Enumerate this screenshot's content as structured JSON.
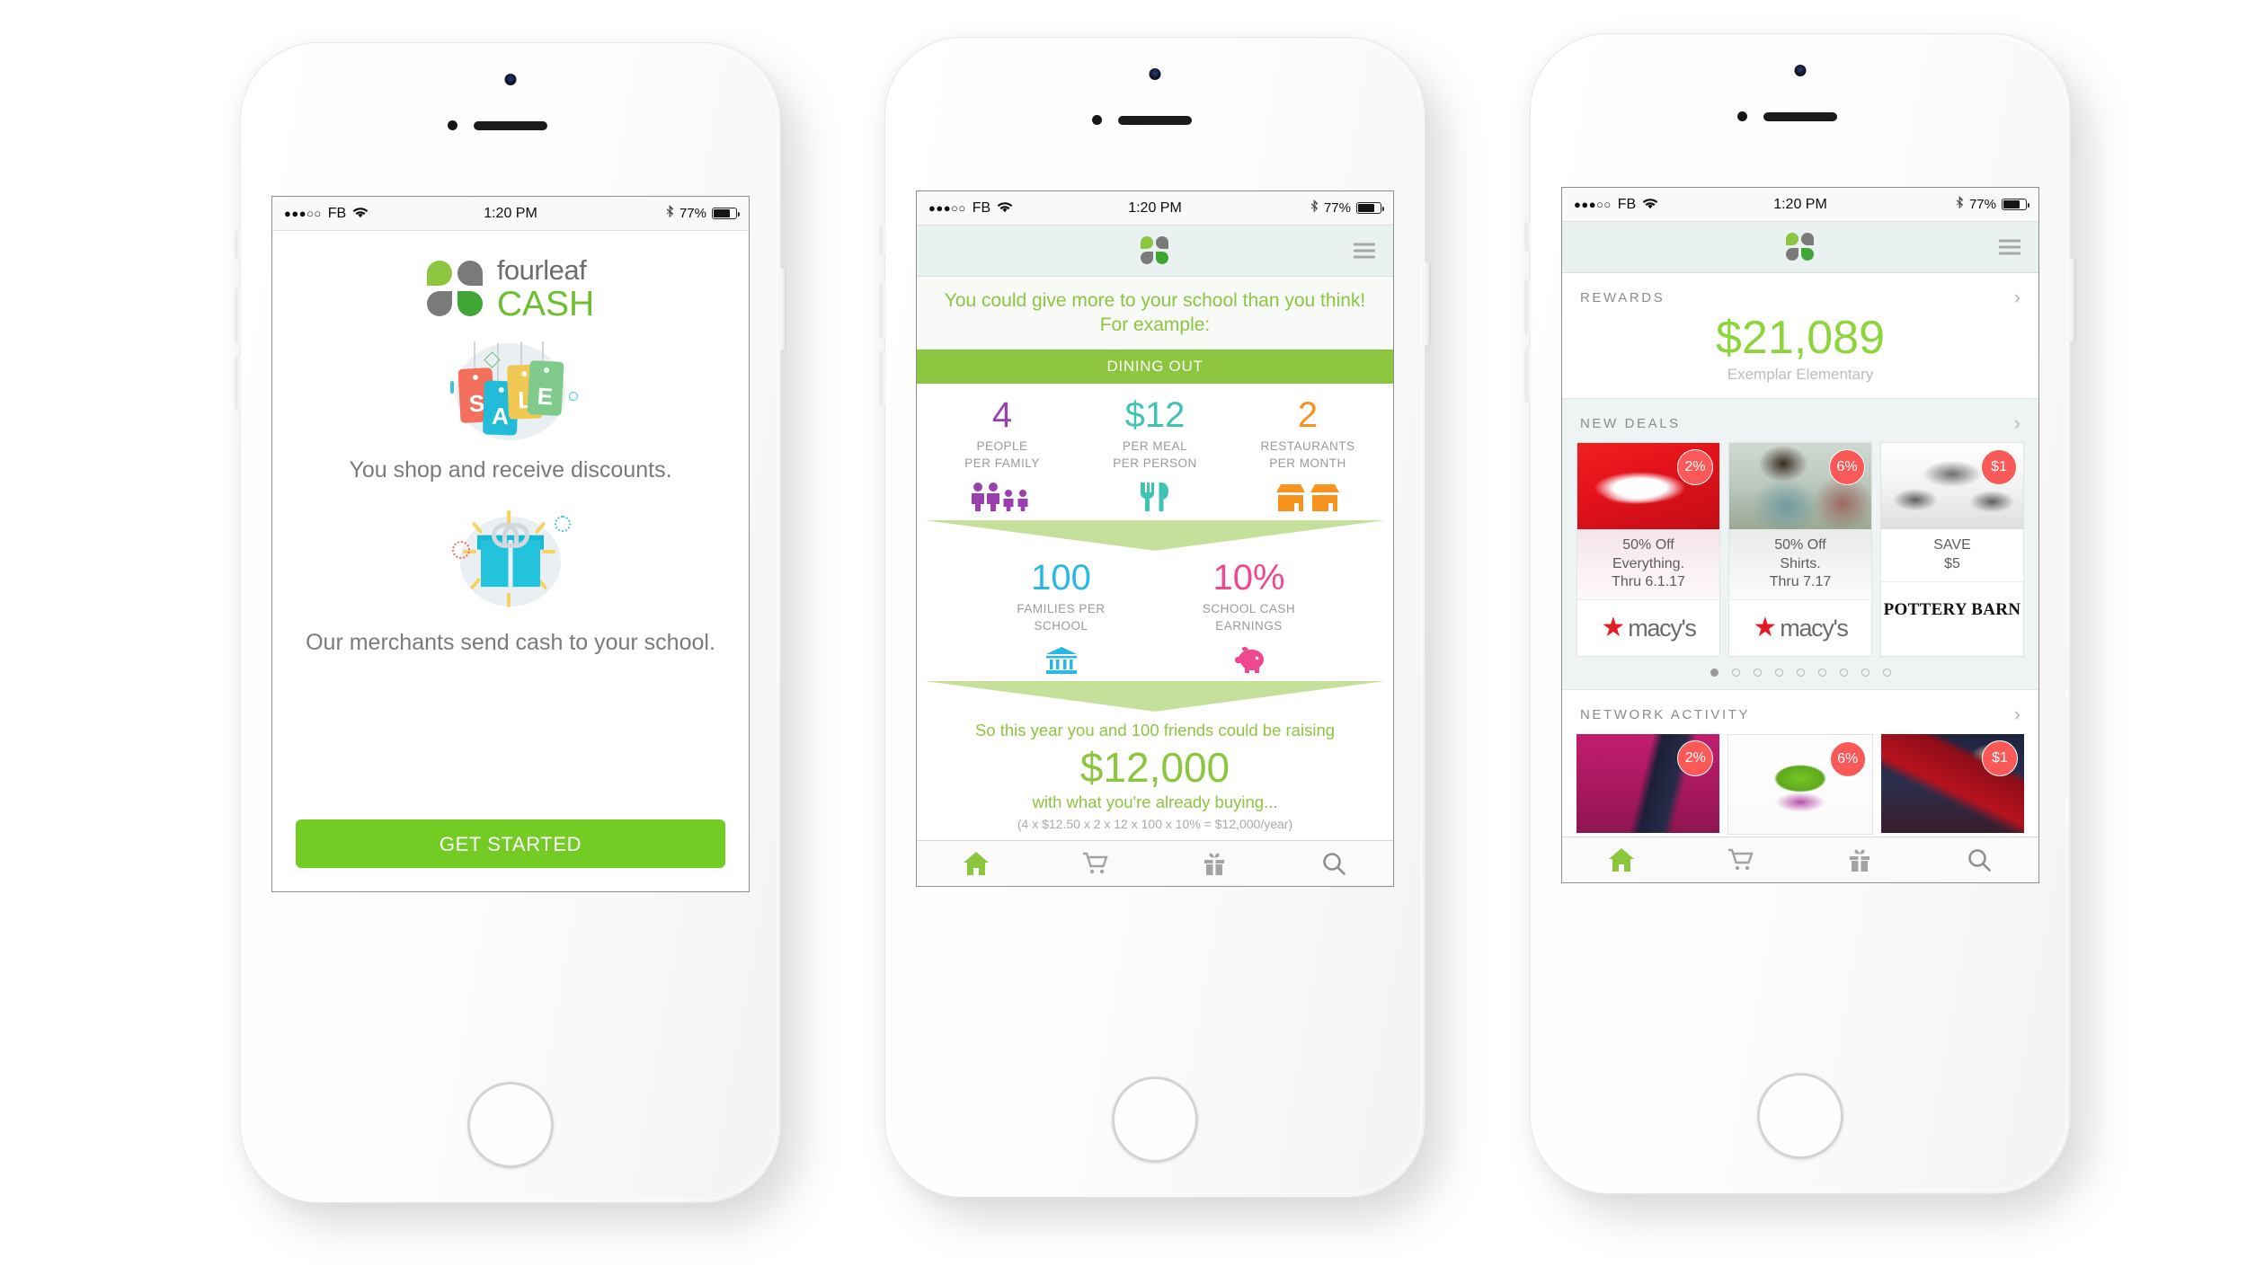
{
  "status_bar": {
    "signal_dots": "●●●○○",
    "carrier": "FB",
    "wifi_icon": "wifi-icon",
    "time": "1:20 PM",
    "bluetooth_icon": "bluetooth-icon",
    "battery_percent": "77%",
    "battery_icon": "battery-icon"
  },
  "brand": {
    "logo_icon": "fourleaf-logo-icon",
    "name_top": "fourleaf",
    "name_bottom": "CASH",
    "color_green": "#6cbf2e",
    "color_gray": "#6d6d6d"
  },
  "phone1": {
    "illustration_1": {
      "icon": "sale-tags-icon",
      "letters": [
        "S",
        "A",
        "L",
        "E"
      ]
    },
    "caption_1": "You shop and receive discounts.",
    "illustration_2": {
      "icon": "gift-box-icon"
    },
    "caption_2": "Our merchants send cash to your school.",
    "cta_label": "GET STARTED",
    "cta_color": "#72cc24"
  },
  "phone2": {
    "nav": {
      "logo_icon": "fourleaf-logo-icon",
      "menu_icon": "hamburger-menu-icon"
    },
    "promo_text": "You could give more to your school than you think! For example:",
    "category_band": "DINING OUT",
    "stats_row_1": [
      {
        "value": "4",
        "label_line1": "PEOPLE",
        "label_line2": "PER FAMILY",
        "color": "#9b3fb0",
        "icon": "family-icon"
      },
      {
        "value": "$12",
        "label_line1": "PER MEAL",
        "label_line2": "PER PERSON",
        "color": "#3fc3b4",
        "icon": "cutlery-icon"
      },
      {
        "value": "2",
        "label_line1": "RESTAURANTS",
        "label_line2": "PER MONTH",
        "color": "#f7931e",
        "icon": "storefront-icon"
      }
    ],
    "stats_row_2": [
      {
        "value": "100",
        "label_line1": "FAMILIES PER",
        "label_line2": "SCHOOL",
        "color": "#29b7e8",
        "icon": "bank-icon"
      },
      {
        "value": "10%",
        "label_line1": "SCHOOL CASH",
        "label_line2": "EARNINGS",
        "color": "#f0478f",
        "icon": "piggy-bank-icon"
      }
    ],
    "summary": {
      "lead": "So this year you and 100 friends could be raising",
      "amount": "$12,000",
      "sub": "with what you're already buying...",
      "formula": "(4 x $12.50 x 2 x 12 x 100 x 10% = $12,000/year)"
    },
    "tabs": [
      {
        "icon": "home-icon",
        "active": true
      },
      {
        "icon": "cart-icon",
        "active": false
      },
      {
        "icon": "gift-icon",
        "active": false
      },
      {
        "icon": "search-icon",
        "active": false
      }
    ]
  },
  "phone3": {
    "nav": {
      "logo_icon": "fourleaf-logo-icon",
      "menu_icon": "hamburger-menu-icon"
    },
    "rewards": {
      "section_title": "REWARDS",
      "chevron_icon": "chevron-right-icon",
      "amount": "$21,089",
      "school": "Exemplar Elementary"
    },
    "new_deals": {
      "section_title": "NEW DEALS",
      "chevron_icon": "chevron-right-icon",
      "cards": [
        {
          "badge": "2%",
          "text_line1": "50% Off",
          "text_line2": "Everything.",
          "text_line3": "Thru 6.1.17",
          "merchant": "macy's",
          "merchant_icon": "macys-star-icon",
          "image": "red-sneaker-photo"
        },
        {
          "badge": "6%",
          "text_line1": "50% Off",
          "text_line2": "Shirts.",
          "text_line3": "Thru 7.17",
          "merchant": "macy's",
          "merchant_icon": "macys-star-icon",
          "image": "plaid-shirt-model-photo"
        },
        {
          "badge": "$1",
          "text_line1": "SAVE",
          "text_line2": "$5",
          "text_line3": "",
          "merchant": "Pottery Barn",
          "merchant_icon": "pottery-barn-wordmark",
          "image": "cookware-pots-photo"
        }
      ],
      "pager_dots": 9,
      "pager_active_index": 0
    },
    "network_activity": {
      "section_title": "NETWORK ACTIVITY",
      "chevron_icon": "chevron-right-icon",
      "cards": [
        {
          "badge": "2%",
          "image": "pink-athletic-pants-photo"
        },
        {
          "badge": "6%",
          "image": "green-lego-brick-photo"
        },
        {
          "badge": "$1",
          "image": "red-fabric-photo"
        }
      ]
    },
    "tabs": [
      {
        "icon": "home-icon",
        "active": true
      },
      {
        "icon": "cart-icon",
        "active": false
      },
      {
        "icon": "gift-icon",
        "active": false
      },
      {
        "icon": "search-icon",
        "active": false
      }
    ]
  }
}
